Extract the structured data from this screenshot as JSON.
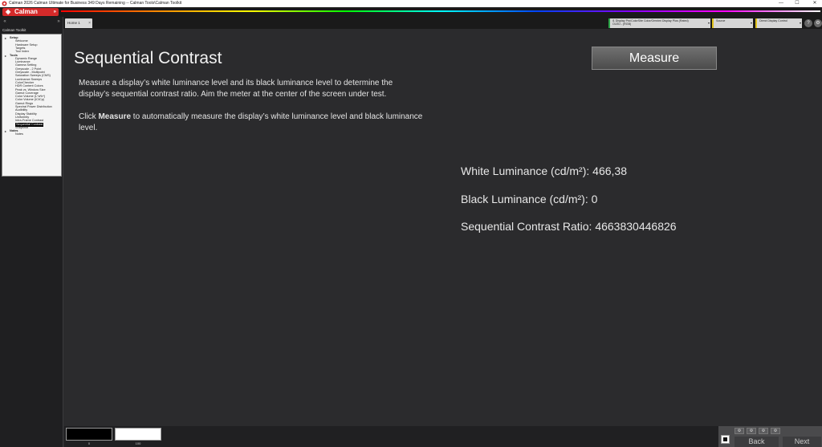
{
  "window": {
    "title": "Calman 2026 Calman Ultimate for Business 349 Days Remaining -- Calman Tools\\Calman Toolkit",
    "minimize": "—",
    "maximize": "☐",
    "close": "✕"
  },
  "brand": {
    "logo_text": "Calman",
    "logo_mark": "◈",
    "logo_arrow": "»"
  },
  "sidebar": {
    "collapse": "«",
    "pin": "»",
    "tree_title": "Calman Toolkit",
    "groups": [
      {
        "label": "Setup",
        "items": [
          "Welcome",
          "Hardware Setup",
          "Targets",
          "Tool Index"
        ]
      },
      {
        "label": "Tools",
        "items": [
          "Dynamic Range",
          "Luminance",
          "Gamma Setting",
          "Greyscale - 2 Point",
          "Greyscale - Multipoint",
          "Saturation Sweeps (CMS)",
          "Luminance Sweeps",
          "ColorChecker",
          "HDR Content Colors",
          "Peak vs. Window Size",
          "Gamut Coverage",
          "Color Volume (L*a*b*)",
          "Color Volume (ICtCp)",
          "Gamut Rings",
          "Spectral Power Distribution",
          "Audibility",
          "Display Stability",
          "Uniformity",
          "Intra-Frame Contrast",
          "Sequential Contrast",
          "Snapshot"
        ]
      },
      {
        "label": "Notes",
        "items": [
          "Notes"
        ]
      }
    ],
    "selected_item": "Sequential Contrast"
  },
  "tabs": [
    {
      "label": "Home 1",
      "close": "×"
    }
  ],
  "dropdowns": [
    {
      "line1": "i1 Display Pro/ColorSite Color/Omnimi Display Plus (Rated)",
      "line2": "OLED - (RGB)",
      "accent": "#2ea64a"
    },
    {
      "line1": "Source",
      "line2": "",
      "accent": "#e0c21c"
    },
    {
      "line1": "Direct Display Control",
      "line2": "",
      "accent": "#e0c21c"
    }
  ],
  "dropdown_arrow": "▾",
  "top_buttons": [
    {
      "label": "?"
    },
    {
      "label": "⚙"
    }
  ],
  "main": {
    "title": "Sequential Contrast",
    "measure_button": "Measure",
    "description_1": "Measure a display’s white luminance level and its black luminance level to determine the display’s sequential contrast ratio. Aim the meter at the center of the screen under test.",
    "description_2_pre": "Click ",
    "description_2_bold": "Measure",
    "description_2_post": " to automatically measure the display’s white luminance level and black luminance level.",
    "results": {
      "white_label": "White Luminance (cd/m²):",
      "white_value": "466,38",
      "black_label": "Black Luminance (cd/m²):",
      "black_value": "0",
      "ratio_label": "Sequential Contrast Ratio:",
      "ratio_value": "4663830446826"
    }
  },
  "bottom": {
    "swatches": [
      {
        "label": "0",
        "color": "#000000"
      },
      {
        "label": "100",
        "color": "#ffffff"
      }
    ],
    "nav_small": [
      "⚙",
      "⚙",
      "⚙",
      "⚙"
    ],
    "back_label": "Back",
    "next_label": "Next"
  },
  "colors": {
    "brand_red": "#d42a2a",
    "background": "#2b2b2d"
  }
}
